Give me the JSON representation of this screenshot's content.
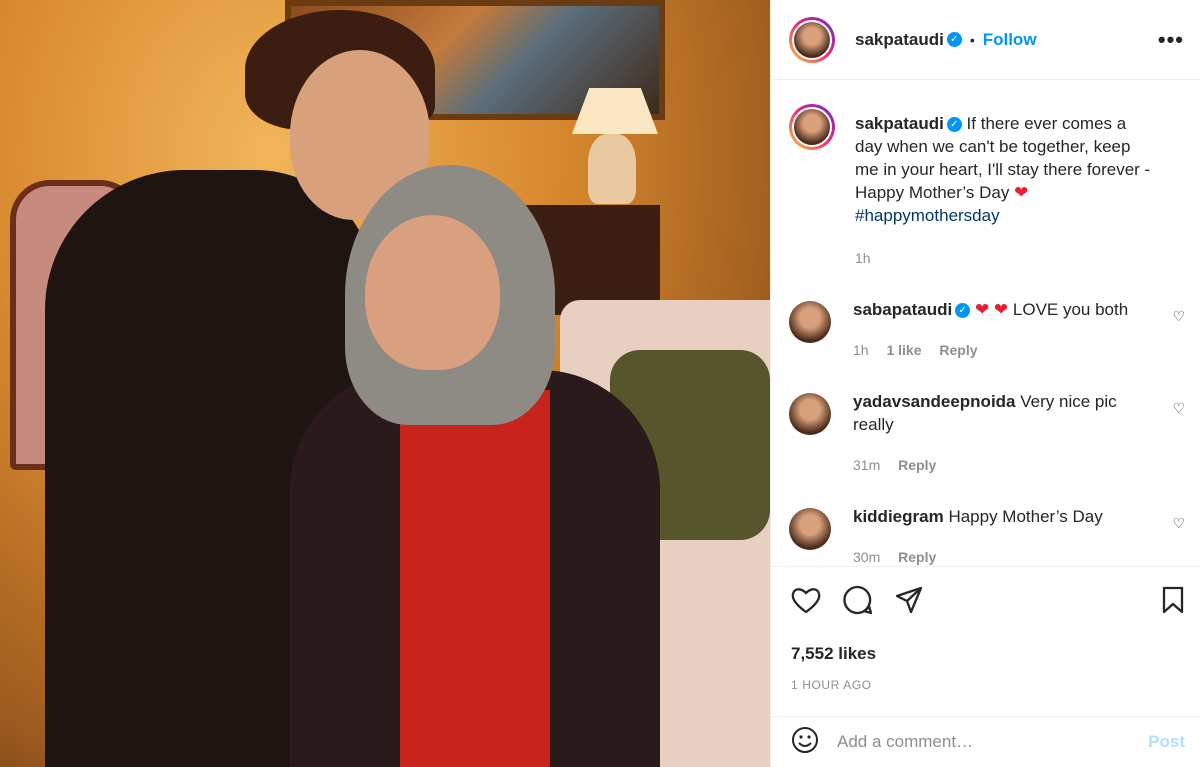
{
  "post": {
    "username": "sakpataudi",
    "follow_label": "Follow",
    "more_icon": "more-options-icon"
  },
  "caption": {
    "username": "sakpataudi",
    "text": "If there ever comes a day when we can't be together, keep me in your heart, I'll stay there forever - Happy Mother’s Day",
    "hashtag": "#happymothersday",
    "time": "1h"
  },
  "comments": [
    {
      "username": "sabapataudi",
      "verified": true,
      "text": "LOVE you both",
      "time": "1h",
      "likes": "1 like",
      "reply": "Reply"
    },
    {
      "username": "yadavsandeepnoida",
      "verified": false,
      "text": "Very nice pic really",
      "time": "31m",
      "reply": "Reply"
    },
    {
      "username": "kiddiegram",
      "verified": false,
      "text": "Happy Mother’s Day",
      "time": "30m",
      "reply": "Reply"
    }
  ],
  "stats": {
    "likes": "7,552 likes",
    "posted": "1 HOUR AGO"
  },
  "comment_box": {
    "placeholder": "Add a comment…",
    "post_label": "Post"
  },
  "colors": {
    "accent": "#0095f6",
    "post_disabled": "#b2dffc",
    "heart_red": "#ed1c2e"
  }
}
